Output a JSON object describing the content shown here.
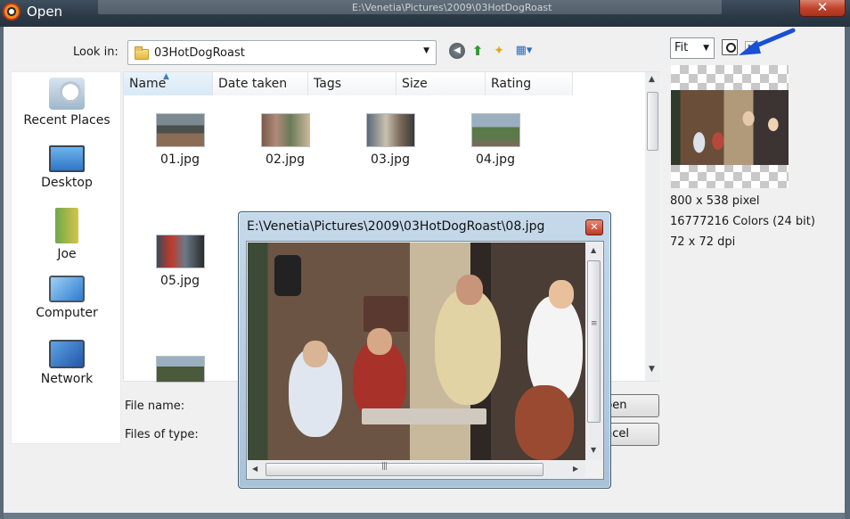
{
  "window": {
    "title": "Open",
    "close_label": "✕",
    "background_path_text": "E:\\Venetia\\Pictures\\2009\\03HotDogRoast"
  },
  "lookin": {
    "label": "Look in:",
    "value": "03HotDogRoast"
  },
  "places": [
    {
      "label": "Recent Places",
      "icon": "recent-places-icon"
    },
    {
      "label": "Desktop",
      "icon": "desktop-icon"
    },
    {
      "label": "Joe",
      "icon": "user-folder-icon"
    },
    {
      "label": "Computer",
      "icon": "computer-icon"
    },
    {
      "label": "Network",
      "icon": "network-icon"
    }
  ],
  "filelist": {
    "columns": [
      "Name",
      "Date taken",
      "Tags",
      "Size",
      "Rating"
    ],
    "sorted_column": "Name",
    "files": [
      "01.jpg",
      "02.jpg",
      "03.jpg",
      "04.jpg",
      "05.jpg"
    ]
  },
  "form": {
    "filename_label": "File name:",
    "filetype_label": "Files of type:",
    "open_button": "pen",
    "cancel_button": "ncel"
  },
  "preview": {
    "fit_value": "Fit",
    "dimensions": "800 x 538 pixel",
    "colors": "16777216 Colors (24 bit)",
    "dpi": "72 x 72 dpi",
    "accent_arrow_color": "#1a4fd6"
  },
  "viewer": {
    "title": "E:\\Venetia\\Pictures\\2009\\03HotDogRoast\\08.jpg",
    "close_label": "✕"
  }
}
